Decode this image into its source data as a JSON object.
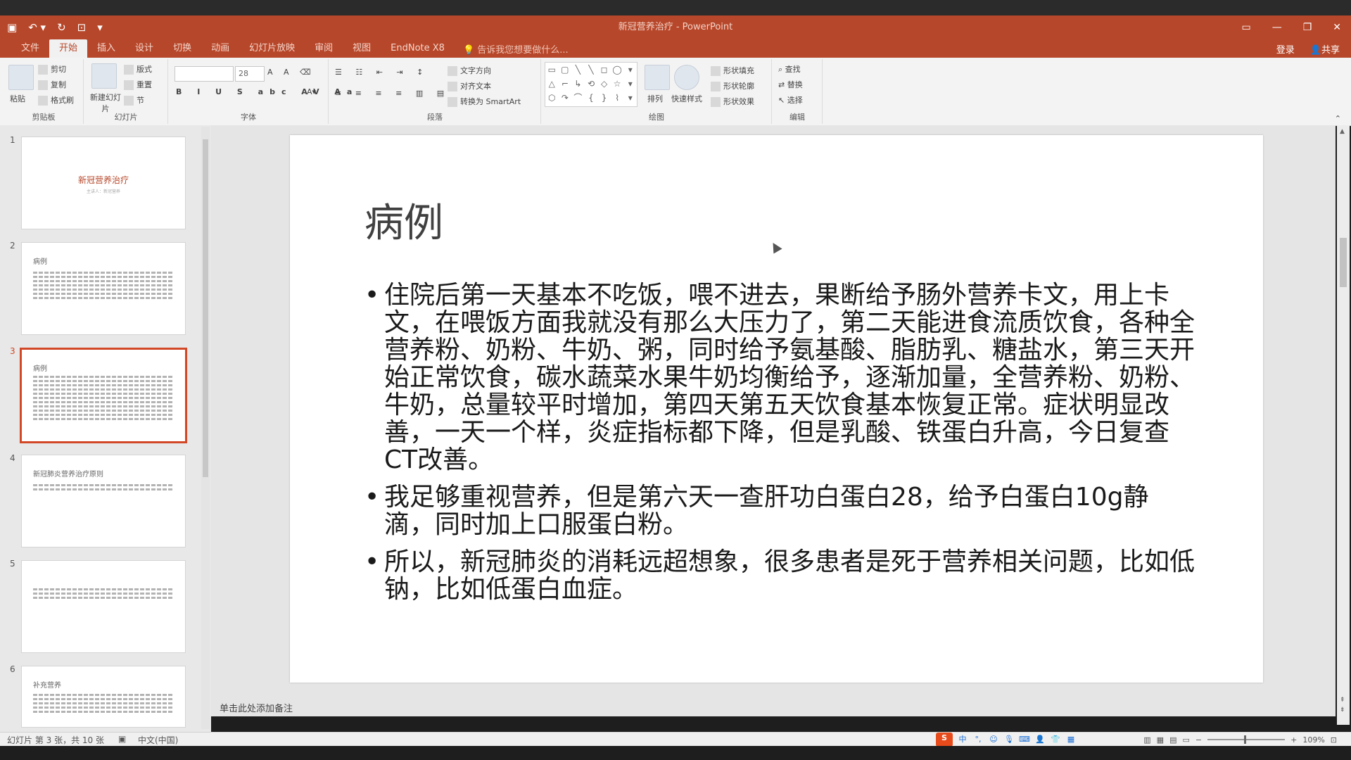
{
  "window": {
    "title": "新冠营养治疗 - PowerPoint",
    "qat_icons": [
      "save-icon",
      "undo-icon",
      "redo-icon",
      "start-slideshow-icon",
      "customize-qat-icon"
    ],
    "controls": [
      "ribbon-display-icon",
      "minimize-icon",
      "restore-icon",
      "close-icon"
    ]
  },
  "ribbon": {
    "tabs": [
      "文件",
      "开始",
      "插入",
      "设计",
      "切换",
      "动画",
      "幻灯片放映",
      "审阅",
      "视图",
      "EndNote X8"
    ],
    "active_tab": "开始",
    "tell_me": "告诉我您想要做什么...",
    "right": {
      "login": "登录",
      "share": "共享"
    },
    "groups": [
      {
        "label": "剪贴板",
        "buttons": [
          "粘贴",
          "剪切",
          "复制",
          "格式刷"
        ]
      },
      {
        "label": "幻灯片",
        "buttons": [
          "新建幻灯片",
          "版式",
          "重置",
          "节"
        ]
      },
      {
        "label": "字体",
        "font_size": "28"
      },
      {
        "label": "段落",
        "buttons": [
          "文字方向",
          "对齐文本",
          "转换为 SmartArt"
        ]
      },
      {
        "label": "绘图",
        "buttons": [
          "排列",
          "快速样式",
          "形状填充",
          "形状轮廓",
          "形状效果"
        ]
      },
      {
        "label": "编辑",
        "buttons": [
          "查找",
          "替换",
          "选择"
        ]
      }
    ]
  },
  "thumbnails": [
    {
      "num": "1",
      "title": "新冠营养治疗",
      "subtitle": "主讲人：新冠营养"
    },
    {
      "num": "2",
      "title": "病例"
    },
    {
      "num": "3",
      "title": "病例"
    },
    {
      "num": "4",
      "title": "新冠肺炎营养治疗原则"
    },
    {
      "num": "5",
      "title": ""
    },
    {
      "num": "6",
      "title": "补充营养"
    }
  ],
  "slide": {
    "title": "病例",
    "bullets": [
      "住院后第一天基本不吃饭，喂不进去，果断给予肠外营养卡文，用上卡文，在喂饭方面我就没有那么大压力了，第二天能进食流质饮食，各种全营养粉、奶粉、牛奶、粥，同时给予氨基酸、脂肪乳、糖盐水，第三天开始正常饮食，碳水蔬菜水果牛奶均衡给予，逐渐加量，全营养粉、奶粉、牛奶，总量较平时增加，第四天第五天饮食基本恢复正常。症状明显改善，一天一个样，炎症指标都下降，但是乳酸、铁蛋白升高，今日复查CT改善。",
      "我足够重视营养，但是第六天一查肝功白蛋白28，给予白蛋白10g静滴，同时加上口服蛋白粉。",
      "所以，新冠肺炎的消耗远超想象，很多患者是死于营养相关问题，比如低钠，比如低蛋白血症。"
    ]
  },
  "notes_placeholder": "单击此处添加备注",
  "status": {
    "slide_info": "幻灯片 第 3 张，共 10 张",
    "language": "中文(中国)",
    "zoom": "109%"
  },
  "colors": {
    "accent": "#b7472a",
    "selection": "#d24726"
  }
}
